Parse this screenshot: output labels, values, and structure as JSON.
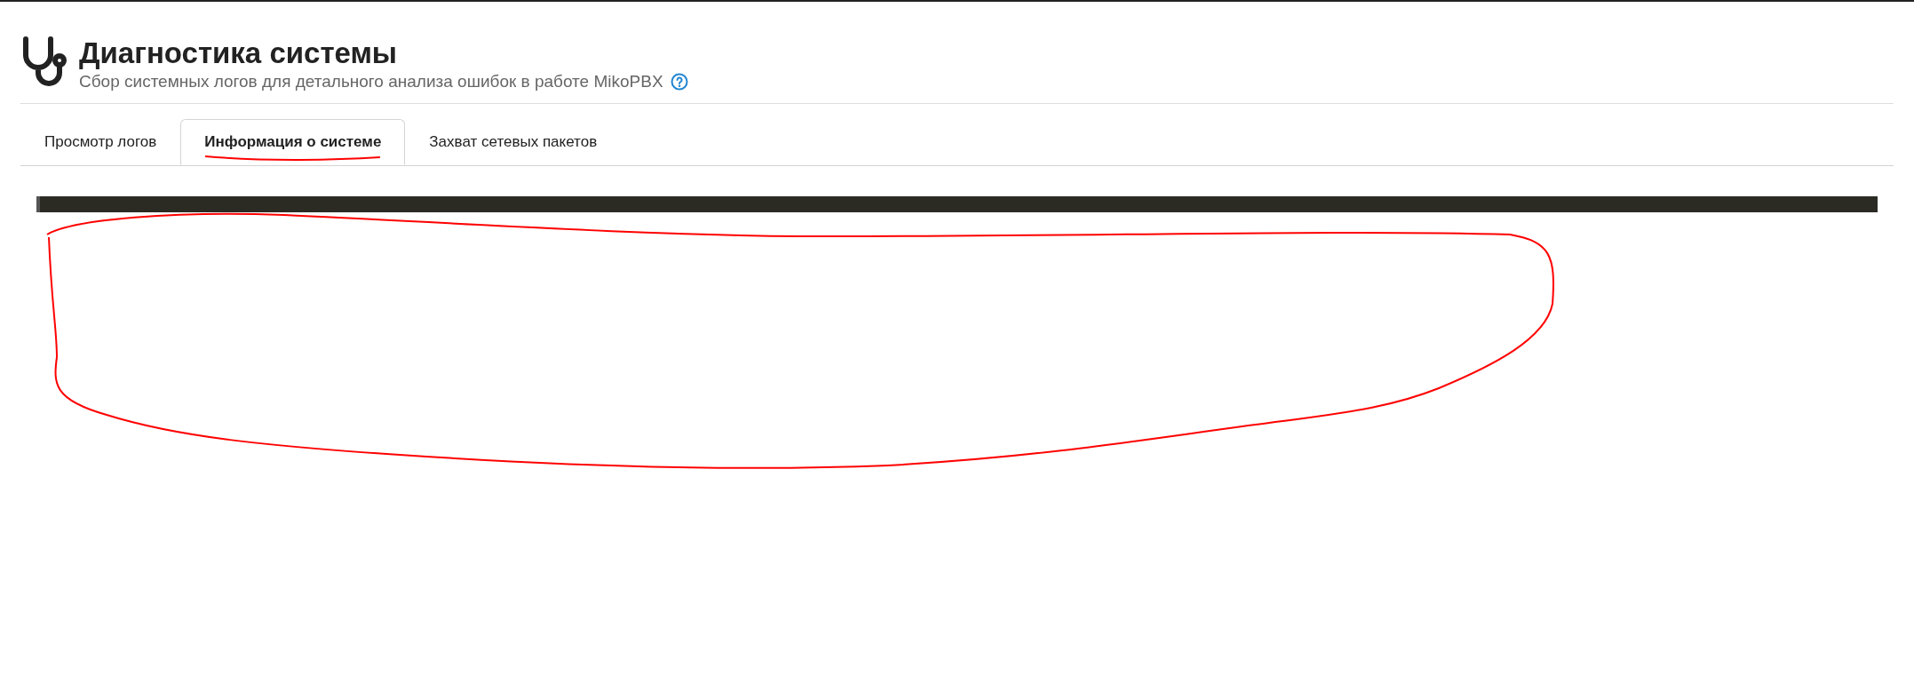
{
  "header": {
    "title": "Диагностика системы",
    "subtitle": "Сбор системных логов для детального анализа ошибок в работе MikoPBX"
  },
  "tabs": [
    {
      "label": "Просмотр логов",
      "selected": false
    },
    {
      "label": "Информация о системе",
      "selected": true
    },
    {
      "label": "Захват сетевых пакетов",
      "selected": false
    }
  ]
}
